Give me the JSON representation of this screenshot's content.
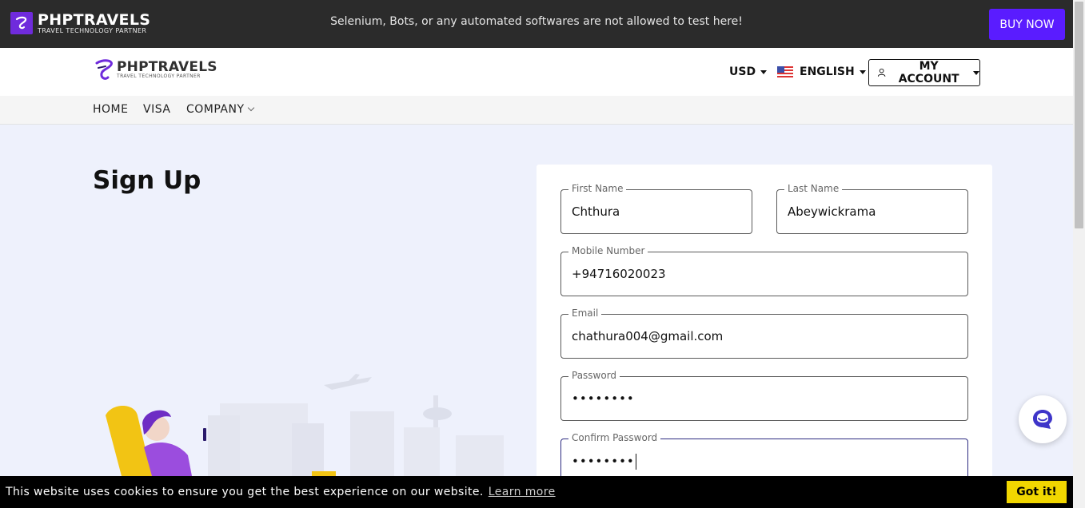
{
  "topbar": {
    "brand_name": "PHPTRAVELS",
    "brand_tagline": "TRAVEL TECHNOLOGY PARTNER",
    "notice": "Selenium, Bots, or any automated softwares are not allowed to test here!",
    "buy_now": "BUY NOW"
  },
  "header": {
    "logo_name": "PHPTRAVELS",
    "logo_tagline": "TRAVEL TECHNOLOGY PARTNER",
    "currency": "USD",
    "language": "ENGLISH",
    "account": "MY ACCOUNT"
  },
  "nav": {
    "home": "HOME",
    "visa": "VISA",
    "company": "COMPANY"
  },
  "page": {
    "title": "Sign Up"
  },
  "form": {
    "first_name_label": "First Name",
    "first_name_value": "Chthura",
    "last_name_label": "Last Name",
    "last_name_value": "Abeywickrama",
    "mobile_label": "Mobile Number",
    "mobile_value": "+94716020023",
    "email_label": "Email",
    "email_value": "chathura004@gmail.com",
    "password_label": "Password",
    "password_value": "••••••••",
    "confirm_label": "Confirm Password",
    "confirm_value": "••••••••"
  },
  "cookie": {
    "message": "This website uses cookies to ensure you get the best experience on our website.",
    "learn_more": "Learn more",
    "got_it": "Got it!"
  },
  "colors": {
    "accent": "#5a1cff",
    "brand_purple": "#6f2bdc",
    "cookie_button": "#f1d600"
  }
}
